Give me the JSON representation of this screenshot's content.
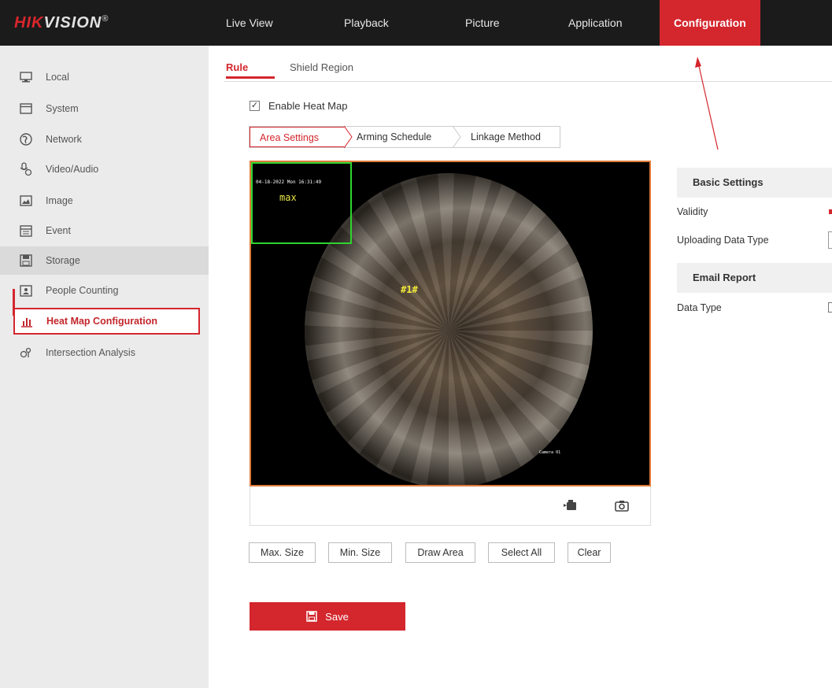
{
  "header": {
    "logo_red": "HIK",
    "logo_rest": "VISION",
    "logo_mark": "®",
    "nav": [
      "Live View",
      "Playback",
      "Picture",
      "Application",
      "Configuration"
    ]
  },
  "sidebar": {
    "items": [
      {
        "label": "Local",
        "icon": "monitor-icon"
      },
      {
        "label": "System",
        "icon": "window-icon"
      },
      {
        "label": "Network",
        "icon": "globe-icon"
      },
      {
        "label": "Video/Audio",
        "icon": "audio-video-icon"
      },
      {
        "label": "Image",
        "icon": "image-icon"
      },
      {
        "label": "Event",
        "icon": "calendar-icon"
      },
      {
        "label": "Storage",
        "icon": "save-icon"
      },
      {
        "label": "People Counting",
        "icon": "people-counting-icon"
      },
      {
        "label": "Heat Map Configuration",
        "icon": "bar-chart-icon"
      },
      {
        "label": "Intersection Analysis",
        "icon": "intersection-icon"
      }
    ]
  },
  "tabs": {
    "rule": "Rule",
    "shield": "Shield Region"
  },
  "enable_heat_map": {
    "label": "Enable Heat Map",
    "checked": true
  },
  "steps": [
    "Area Settings",
    "Arming Schedule",
    "Linkage Method"
  ],
  "video": {
    "osd_date": "04-18-2022 Mon 16:31:49",
    "max_label": "max",
    "area_label": "#1#",
    "camera_label": "Camera 01"
  },
  "buttons": {
    "max_size": "Max. Size",
    "min_size": "Min. Size",
    "draw_area": "Draw Area",
    "select_all": "Select All",
    "clear": "Clear",
    "save": "Save"
  },
  "right_panel": {
    "basic_settings": "Basic Settings",
    "validity": "Validity",
    "uploading_data_type": "Uploading Data Type",
    "email_report": "Email Report",
    "data_type": "Data Type"
  },
  "colors": {
    "accent": "#d4262d",
    "topbar": "#1b1b1b",
    "sidebar": "#ebebeb",
    "detection_box": "#2fd42f"
  }
}
